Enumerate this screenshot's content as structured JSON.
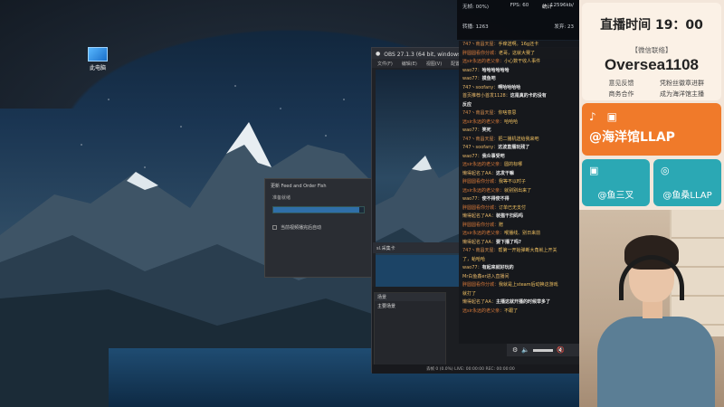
{
  "desktop": {
    "icon_label": "此电脑"
  },
  "progress_dialog": {
    "title": "更新 Feed and Order Fish",
    "subtitle": "准备就绪",
    "checkbox_label": "当前视频播完后自动",
    "progress": 0.95
  },
  "obs": {
    "title": "OBS 27.1.3 (64 bit, windows) - 配置文件",
    "menu": [
      "文件(F)",
      "编辑(E)",
      "视图(V)",
      "配置文件"
    ],
    "scenes_header": "场景",
    "scene_item": "主要场景",
    "sources_header": "来源",
    "source_label": "sl.采集卡",
    "status_text": "丢帧 0 (0.0%)   LIVE: 00:00:00   REC: 00:00:00"
  },
  "stats": {
    "panel_title": "统计",
    "cpu": "无帧: 00%)",
    "fps": "FPS: 60",
    "bitrate": "12596kb/",
    "views": "转播: 1263",
    "sent": "发弃: 23"
  },
  "chat": [
    {
      "user": "747丶南昌天屋：",
      "text": "手痒送啊。16g还卡",
      "sys": true,
      "u": "u2"
    },
    {
      "user": "胖圆圆看你分城：",
      "text": "老哥，这就大赛了",
      "sys": true,
      "u": "u3"
    },
    {
      "user": "远sir永远的老父亲：",
      "text": "小心数干收人事件",
      "sys": true,
      "u": "u3"
    },
    {
      "user": "wao77：",
      "text": "哈哈哈哈哈哈",
      "sys": false,
      "u": "u1"
    },
    {
      "user": "wao77：",
      "text": "摸鱼吧",
      "sys": false,
      "u": "u1"
    },
    {
      "user": "747丶soofany：",
      "text": "啊哈哈哈哈",
      "sys": false,
      "u": "u1"
    },
    {
      "user": "首页推荐小首发1128：",
      "text": "这是真的卡的没有",
      "sys": false,
      "u": "u1"
    },
    {
      "user": "",
      "text": "反应",
      "sys": false,
      "u": "u1"
    },
    {
      "user": "747丶南昌天屋：",
      "text": "你啥意思",
      "sys": true,
      "u": "u2"
    },
    {
      "user": "远sir永远的老父亲：",
      "text": "哈哈哈",
      "sys": true,
      "u": "u3"
    },
    {
      "user": "wao77：",
      "text": "笑死",
      "sys": false,
      "u": "u1"
    },
    {
      "user": "747丶南昌天屋：",
      "text": "把二播机送给我来吧",
      "sys": true,
      "u": "u2"
    },
    {
      "user": "747丶soofany：",
      "text": "这波直播玩残了",
      "sys": false,
      "u": "u1"
    },
    {
      "user": "wao77：",
      "text": "我众事受吧",
      "sys": false,
      "u": "u1"
    },
    {
      "user": "远sir永远的老父亲：",
      "text": "圆的标哪",
      "sys": true,
      "u": "u3"
    },
    {
      "user": "懒得起名了AA：",
      "text": "这发干嘛",
      "sys": false,
      "u": "u1"
    },
    {
      "user": "胖圆圆看你分城：",
      "text": "我等不以时子",
      "sys": true,
      "u": "u3"
    },
    {
      "user": "远sir永远的老父亲：",
      "text": "就别别出来了",
      "sys": true,
      "u": "u3"
    },
    {
      "user": "wao77：",
      "text": "使不得使不得",
      "sys": false,
      "u": "u1"
    },
    {
      "user": "胖圆圆看你分城：",
      "text": "订单已无支付",
      "sys": true,
      "u": "u3"
    },
    {
      "user": "懒得起名了AA：",
      "text": "装猫干扫码吗",
      "sys": false,
      "u": "u1"
    },
    {
      "user": "胖圆圆看你分城：",
      "text": "赠",
      "sys": true,
      "u": "u3"
    },
    {
      "user": "远sir永远的老父亲：",
      "text": "喉播线、别日来前",
      "sys": true,
      "u": "u3"
    },
    {
      "user": "懒得起名了AA：",
      "text": "要下播了吗?",
      "sys": false,
      "u": "u1"
    },
    {
      "user": "747丶南昌天屋：",
      "text": "帮第一开始弹断大角就上开关",
      "sys": true,
      "u": "u2"
    },
    {
      "user": "",
      "text": "了，蛤哈哈",
      "sys": true,
      "u": "u2"
    },
    {
      "user": "wao77：",
      "text": "有起来就好玩的",
      "sys": false,
      "u": "u1"
    },
    {
      "user": "Mr白鱼鑫er进入直播间",
      "text": "",
      "sys": true,
      "u": "u1"
    },
    {
      "user": "胖圆圆看你分城：",
      "text": "我就是上steam后动换这游戏",
      "sys": true,
      "u": "u3"
    },
    {
      "user": "",
      "text": "就打了",
      "sys": true,
      "u": "u3"
    },
    {
      "user": "懒得起名了AA：",
      "text": "主播这就开播的时候举多了",
      "sys": false,
      "u": "u1"
    },
    {
      "user": "远sir永远的老父亲：",
      "text": "不跟了",
      "sys": true,
      "u": "u3"
    }
  ],
  "sidepanel": {
    "live_time": "直播时间 19：00",
    "wechat_label": "【微信联络】",
    "wechat_id": "Oversea1108",
    "notes": [
      "意见反馈",
      "凭粉丝徽章进群",
      "商务合作",
      "成为海洋馆主播"
    ],
    "douyin_handle": "@海洋馆LLAP",
    "bili_handle": "@鱼三叉",
    "weibo_handle": "@鱼桑LLAP"
  }
}
